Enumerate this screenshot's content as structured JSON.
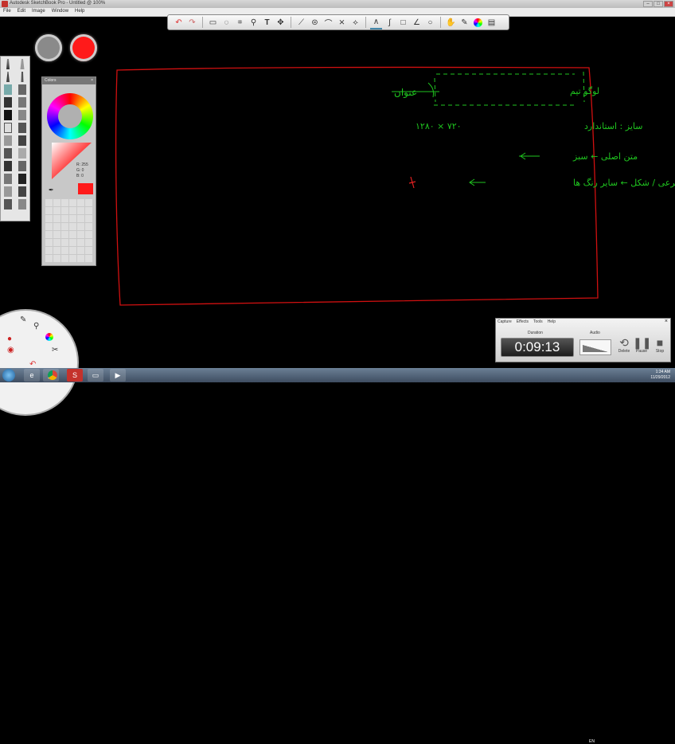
{
  "window": {
    "title": "Autodesk SketchBook Pro - Untitled @ 100%"
  },
  "menu": [
    "File",
    "Edit",
    "Image",
    "Window",
    "Help"
  ],
  "toolbar": {
    "tools": [
      "undo-icon",
      "redo-icon",
      "select-rect-icon",
      "lasso-icon",
      "crop-icon",
      "zoom-icon",
      "text-icon",
      "move-icon",
      "ruler-icon",
      "ellipse-guide-icon",
      "french-curve-icon",
      "symmetry-icon",
      "perspective-icon",
      "line-icon",
      "curve-icon",
      "rect-icon",
      "polyline-icon",
      "ellipse-icon",
      "hand-icon",
      "brush-palette-icon",
      "color-wheel-icon",
      "layers-icon"
    ]
  },
  "colors_panel": {
    "title": "Colors",
    "r_label": "R:",
    "r": "255",
    "g_label": "G:",
    "g": "0",
    "b_label": "B:",
    "b": "0",
    "current_color": "#ff1a1a"
  },
  "pucks": {
    "brush_size_color": "#8a8a8a",
    "color_puck": "#ff1a1a"
  },
  "canvas": {
    "frame_color": "#d01010",
    "ink_color": "#1fc41f",
    "lines": [
      "لوگو تیم",
      "عنوان",
      "سایز : استاندارد",
      "۱۲۸۰ × ۷۲۰",
      "متن اصلی ← سبز",
      "توضیحات فرعی / شکل ← سایر رنگ ها"
    ]
  },
  "recorder": {
    "menu": [
      "Capture",
      "Effects",
      "Tools",
      "Help"
    ],
    "duration_label": "Duration",
    "audio_label": "Audio",
    "timer": "0:09:13",
    "buttons": [
      "Delete",
      "Pause",
      "Stop"
    ]
  },
  "taskbar": {
    "lang": "EN",
    "time": "1:34 AM",
    "date": "11/29/2012"
  }
}
